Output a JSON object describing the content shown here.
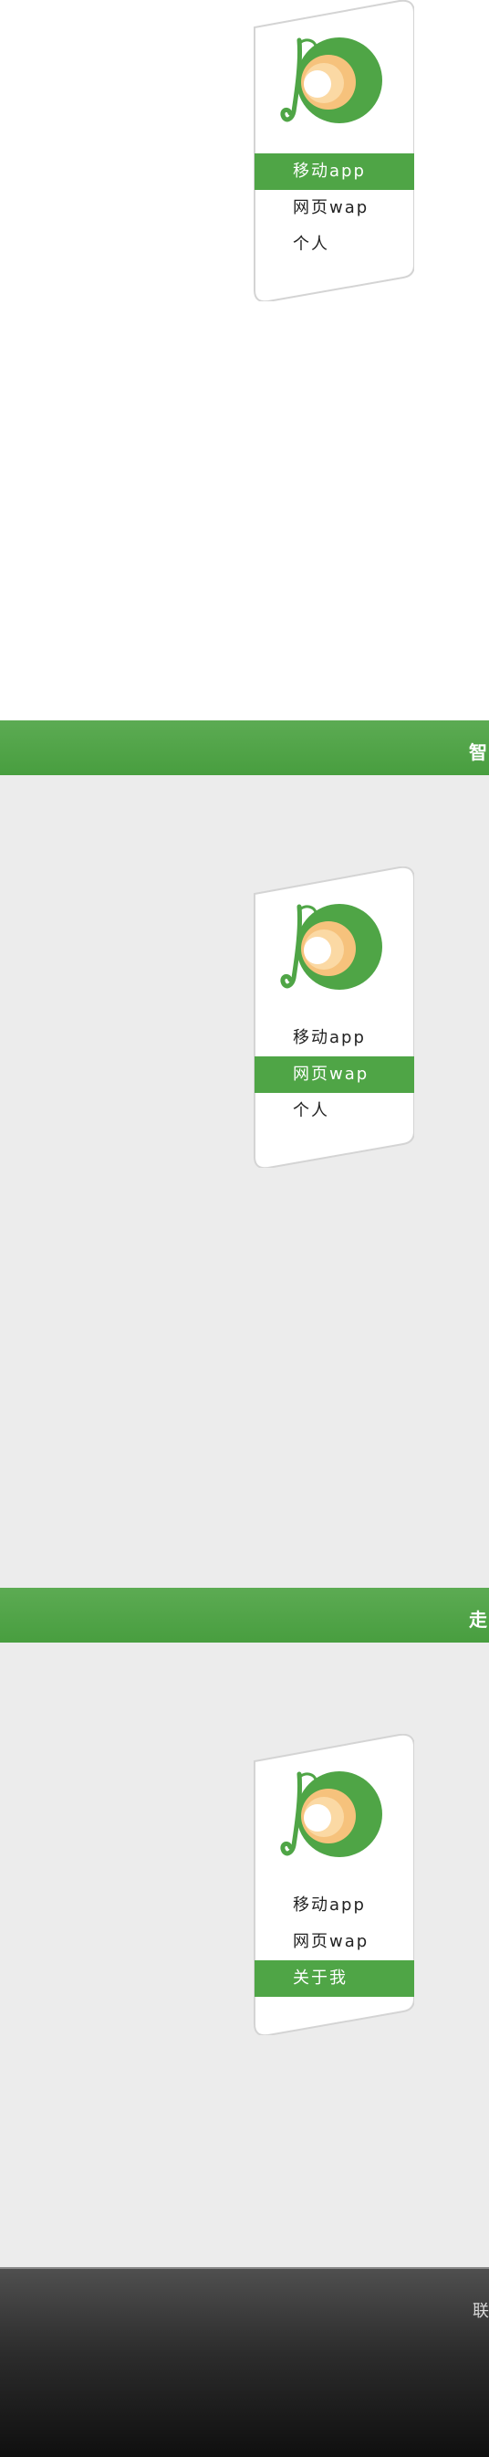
{
  "colors": {
    "brand_green": "#4fa546",
    "panel_grey": "#ececec"
  },
  "section1": {
    "menu": [
      {
        "label": "移动app",
        "active": true
      },
      {
        "label": "网页wap",
        "active": false
      },
      {
        "label": "个人",
        "active": false
      }
    ]
  },
  "section2": {
    "band_title": "智",
    "menu": [
      {
        "label": "移动app",
        "active": false
      },
      {
        "label": "网页wap",
        "active": true
      },
      {
        "label": "个人",
        "active": false
      }
    ]
  },
  "section3": {
    "band_title": "走",
    "menu": [
      {
        "label": "移动app",
        "active": false
      },
      {
        "label": "网页wap",
        "active": false
      },
      {
        "label": "关于我",
        "active": true
      }
    ]
  },
  "footer": {
    "text": "联"
  }
}
